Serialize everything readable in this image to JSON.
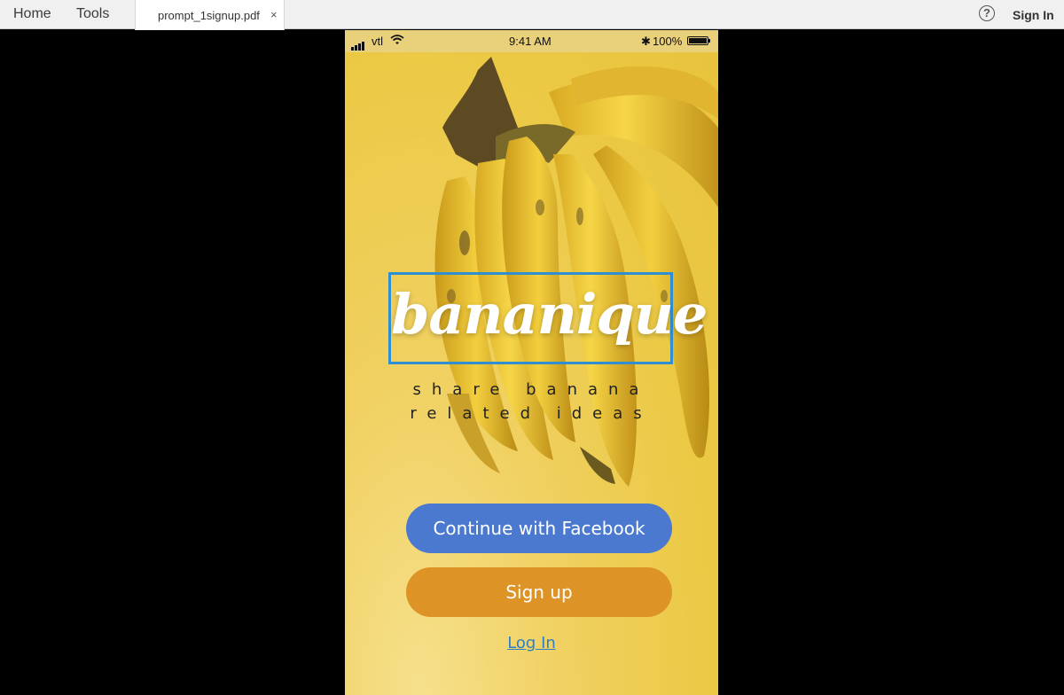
{
  "toolbar": {
    "home_label": "Home",
    "tools_label": "Tools",
    "signin_label": "Sign In",
    "help_icon": "?"
  },
  "tab": {
    "file_name": "prompt_1signup.pdf",
    "close_glyph": "×"
  },
  "phone": {
    "status": {
      "carrier": "vtl",
      "time": "9:41 AM",
      "battery": "100%"
    },
    "logo": "bananique",
    "tagline": [
      "share banana",
      "related ideas"
    ],
    "buttons": {
      "facebook": "Continue with Facebook",
      "signup": "Sign up"
    },
    "login_link": "Log In"
  },
  "colors": {
    "background": "#ebc944",
    "facebook_button": "#4a79cf",
    "signup_button": "#de9326",
    "logo_border": "#2f8fd0",
    "link": "#2f7fc4"
  }
}
